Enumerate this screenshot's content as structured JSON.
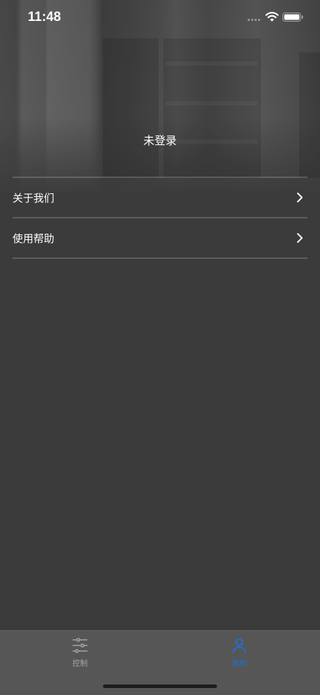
{
  "status_bar": {
    "time": "11:48"
  },
  "profile": {
    "login_status": "未登录"
  },
  "menu": {
    "items": [
      {
        "label": "关于我们",
        "icon": "chevron-right-icon"
      },
      {
        "label": "使用帮助",
        "icon": "chevron-right-icon"
      }
    ]
  },
  "tab_bar": {
    "tabs": [
      {
        "label": "控制",
        "icon": "sliders-icon",
        "active": false
      },
      {
        "label": "我的",
        "icon": "person-icon",
        "active": true
      }
    ],
    "active_color": "#1f6fd6",
    "inactive_color": "#a5a5a5"
  }
}
